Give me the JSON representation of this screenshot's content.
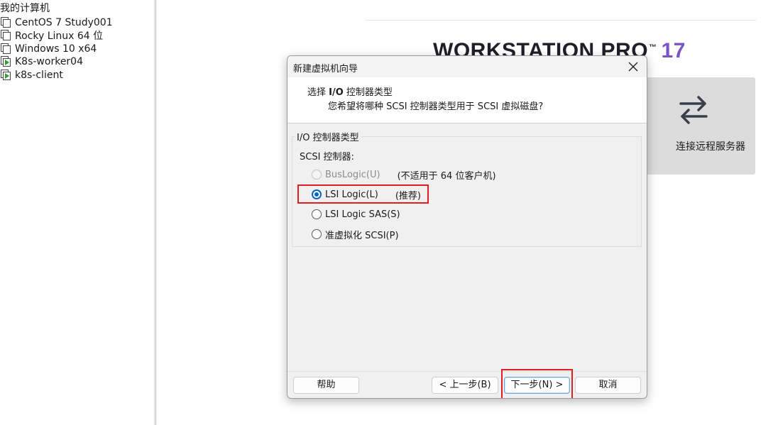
{
  "library": {
    "root_label": "我的计算机",
    "vms": [
      {
        "name": "CentOS 7 Study001",
        "running": false
      },
      {
        "name": "Rocky Linux 64 位",
        "running": false
      },
      {
        "name": "Windows 10 x64",
        "running": false
      },
      {
        "name": "K8s-worker04",
        "running": true
      },
      {
        "name": "k8s-client",
        "running": true
      }
    ]
  },
  "home": {
    "brand": "WORKSTATION PRO",
    "trademark": "™",
    "version": "17",
    "remote_tile_label": "连接远程服务器",
    "remote_tile_icon": "swap-arrows-icon"
  },
  "dialog": {
    "title": "新建虚拟机向导",
    "header_title_prefix": "选择 ",
    "header_title_bold": "I/O",
    "header_title_suffix": " 控制器类型",
    "header_subtitle": "您希望将哪种 SCSI 控制器类型用于 SCSI 虚拟磁盘?",
    "group_label": "I/O 控制器类型",
    "scsi_label": "SCSI 控制器:",
    "options": [
      {
        "label": "BusLogic(U)",
        "note": "(不适用于 64 位客户机)",
        "disabled": true,
        "checked": false
      },
      {
        "label": "LSI Logic(L)",
        "note": "(推荐)",
        "disabled": false,
        "checked": true
      },
      {
        "label": "LSI Logic SAS(S)",
        "note": "",
        "disabled": false,
        "checked": false
      },
      {
        "label": "准虚拟化 SCSI(P)",
        "note": "",
        "disabled": false,
        "checked": false
      }
    ],
    "buttons": {
      "help": "帮助",
      "back": "< 上一步(B)",
      "next": "下一步(N) >",
      "cancel": "取消"
    }
  },
  "colors": {
    "accent": "#0067c0",
    "highlight": "#e02020",
    "version_purple": "#7a54c7"
  }
}
